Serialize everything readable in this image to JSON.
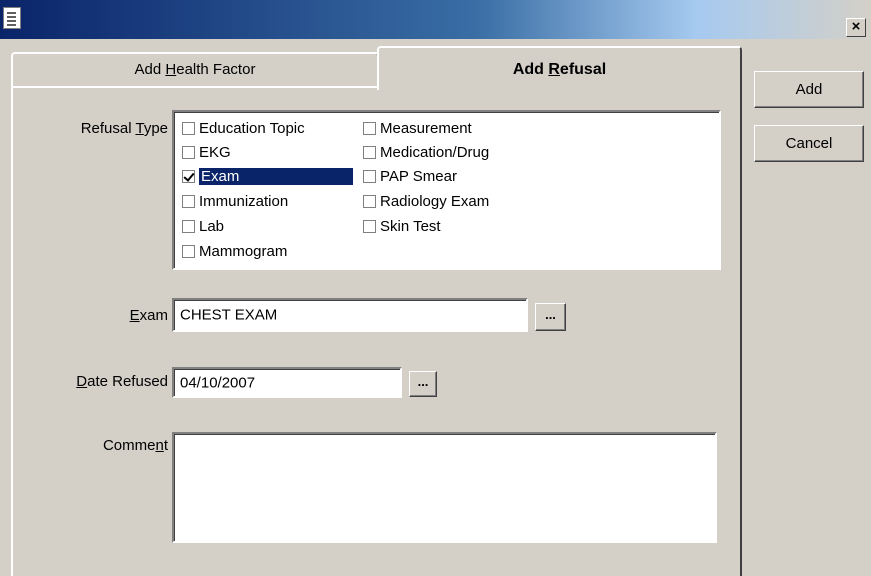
{
  "window": {
    "close_label": "×"
  },
  "tabs": [
    {
      "pre": "Add ",
      "key": "H",
      "post": "ealth Factor",
      "active": false
    },
    {
      "pre": "Add ",
      "key": "R",
      "post": "efusal",
      "active": true
    }
  ],
  "buttons": {
    "add": "Add",
    "cancel": "Cancel"
  },
  "refusal_type": {
    "label_pre": "Refusal ",
    "label_key": "T",
    "label_post": "ype",
    "options": [
      {
        "label": "Education Topic",
        "checked": false
      },
      {
        "label": "EKG",
        "checked": false
      },
      {
        "label": "Exam",
        "checked": true,
        "selected": true
      },
      {
        "label": "Immunization",
        "checked": false
      },
      {
        "label": "Lab",
        "checked": false
      },
      {
        "label": "Mammogram",
        "checked": false
      },
      {
        "label": "Measurement",
        "checked": false
      },
      {
        "label": "Medication/Drug",
        "checked": false
      },
      {
        "label": "PAP Smear",
        "checked": false
      },
      {
        "label": "Radiology Exam",
        "checked": false
      },
      {
        "label": "Skin Test",
        "checked": false
      }
    ]
  },
  "exam": {
    "label_key": "E",
    "label_post": "xam",
    "value": "CHEST EXAM",
    "lookup": "..."
  },
  "date_refused": {
    "label_key": "D",
    "label_post": "ate Refused",
    "value": "04/10/2007",
    "lookup": "..."
  },
  "comment": {
    "label_pre": "Comme",
    "label_key": "n",
    "label_post": "t",
    "value": ""
  }
}
